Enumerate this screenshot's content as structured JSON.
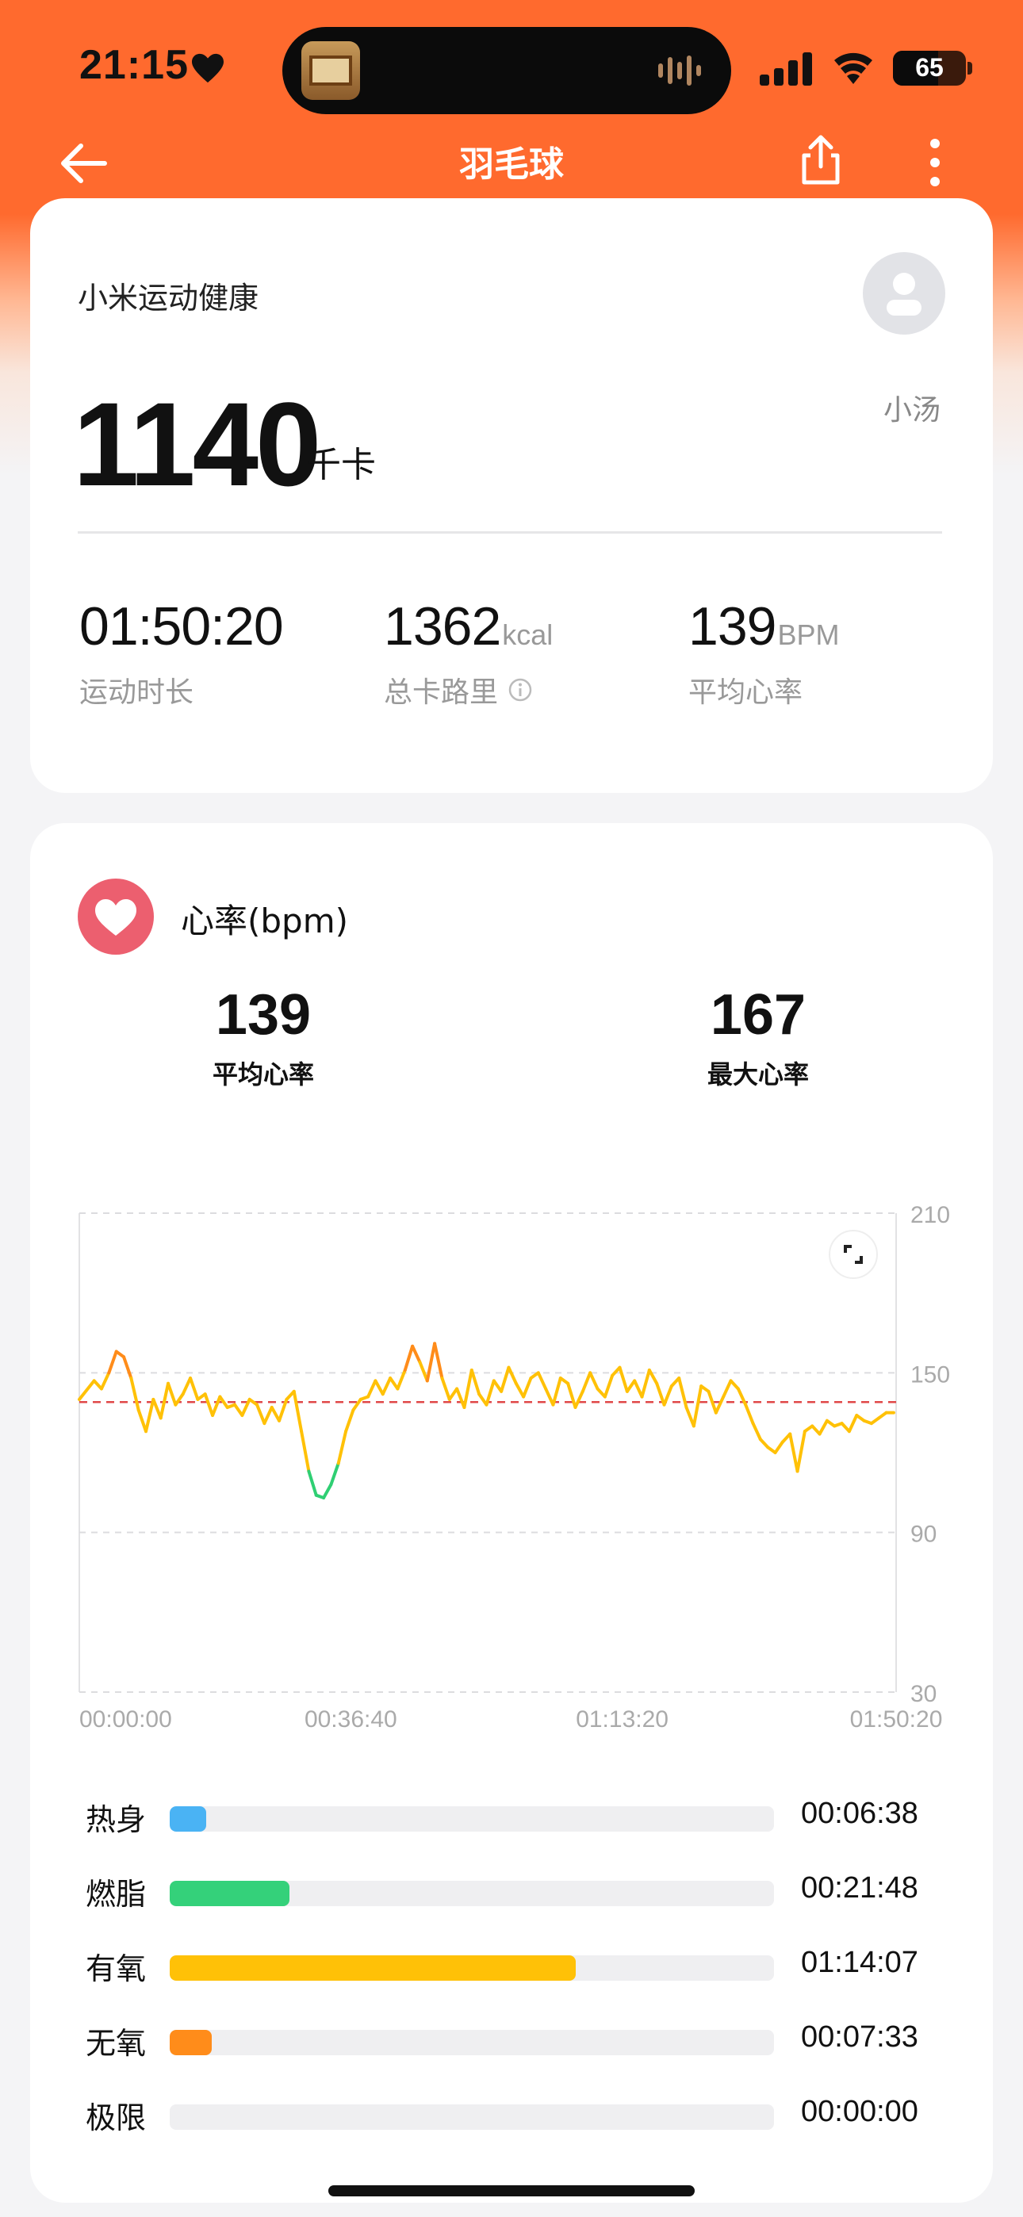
{
  "status_bar": {
    "time": "21:15",
    "battery": "65"
  },
  "nav": {
    "title": "羽毛球"
  },
  "summary": {
    "source": "小米运动健康",
    "user": "小汤",
    "calories_value": "1140",
    "calories_unit": "千卡",
    "stats": [
      {
        "value": "01:50:20",
        "unit": "",
        "label": "运动时长"
      },
      {
        "value": "1362",
        "unit": "kcal",
        "label": "总卡路里"
      },
      {
        "value": "139",
        "unit": "BPM",
        "label": "平均心率"
      }
    ]
  },
  "heart_rate": {
    "title": "心率(bpm)",
    "avg_value": "139",
    "avg_label": "平均心率",
    "max_value": "167",
    "max_label": "最大心率"
  },
  "chart_data": {
    "type": "line",
    "title": "",
    "xlabel": "",
    "ylabel": "",
    "ylim": [
      30,
      210
    ],
    "xlim": [
      "00:00:00",
      "01:50:20"
    ],
    "y_ticks": [
      "210",
      "150",
      "90",
      "30"
    ],
    "x_ticks": [
      "00:00:00",
      "00:36:40",
      "01:13:20",
      "01:50:20"
    ],
    "reference_line": {
      "value": 139,
      "color": "#e04848"
    },
    "series": [
      {
        "x_minutes": [
          0,
          2,
          3,
          4,
          5,
          6,
          7,
          8,
          9,
          10,
          11,
          12,
          13,
          14,
          15,
          16,
          17,
          18,
          19,
          20,
          21,
          22,
          23,
          24,
          25,
          26,
          27,
          28,
          29,
          30,
          31,
          32,
          33,
          34,
          35,
          36,
          37,
          38,
          39,
          40,
          41,
          42,
          43,
          44,
          45,
          46,
          47,
          48,
          49,
          50,
          51,
          52,
          53,
          54,
          55,
          56,
          57,
          58,
          59,
          60,
          61,
          62,
          63,
          64,
          65,
          66,
          67,
          68,
          69,
          70,
          71,
          72,
          73,
          74,
          75,
          76,
          77,
          78,
          79,
          80,
          81,
          82,
          83,
          84,
          85,
          86,
          87,
          88,
          89,
          90,
          91,
          92,
          93,
          94,
          95,
          96,
          97,
          98,
          99,
          100,
          101,
          102,
          103,
          104,
          105,
          106,
          107,
          108,
          109,
          110
        ],
        "values": [
          140,
          147,
          144,
          150,
          158,
          156,
          148,
          136,
          128,
          140,
          133,
          146,
          138,
          142,
          148,
          140,
          142,
          134,
          141,
          137,
          138,
          134,
          140,
          138,
          131,
          137,
          132,
          140,
          143,
          128,
          113,
          104,
          103,
          108,
          116,
          128,
          136,
          140,
          141,
          147,
          142,
          148,
          144,
          151,
          160,
          154,
          147,
          161,
          148,
          140,
          144,
          137,
          151,
          142,
          138,
          147,
          143,
          152,
          146,
          141,
          148,
          150,
          144,
          138,
          148,
          146,
          137,
          143,
          150,
          144,
          141,
          149,
          152,
          143,
          147,
          141,
          151,
          146,
          138,
          145,
          148,
          137,
          130,
          145,
          143,
          135,
          141,
          147,
          144,
          138,
          131,
          125,
          122,
          120,
          124,
          127,
          113,
          128,
          130,
          127,
          132,
          130,
          131,
          128,
          134,
          132,
          131,
          133,
          135,
          135
        ],
        "color_scale": {
          "warmup": "#4ab3f4",
          "fat_burn": "#2fcf73",
          "aerobic": "#ffc107",
          "anaerobic": "#ff8c1a"
        }
      }
    ]
  },
  "zones": [
    {
      "label": "热身",
      "time": "00:06:38",
      "fraction": 0.06,
      "color": "#4ab3f4"
    },
    {
      "label": "燃脂",
      "time": "00:21:48",
      "fraction": 0.198,
      "color": "#34d17a"
    },
    {
      "label": "有氧",
      "time": "01:14:07",
      "fraction": 0.672,
      "color": "#ffc107"
    },
    {
      "label": "无氧",
      "time": "00:07:33",
      "fraction": 0.07,
      "color": "#ff8c1a"
    },
    {
      "label": "极限",
      "time": "00:00:00",
      "fraction": 0,
      "color": "#ff3b3b"
    }
  ]
}
